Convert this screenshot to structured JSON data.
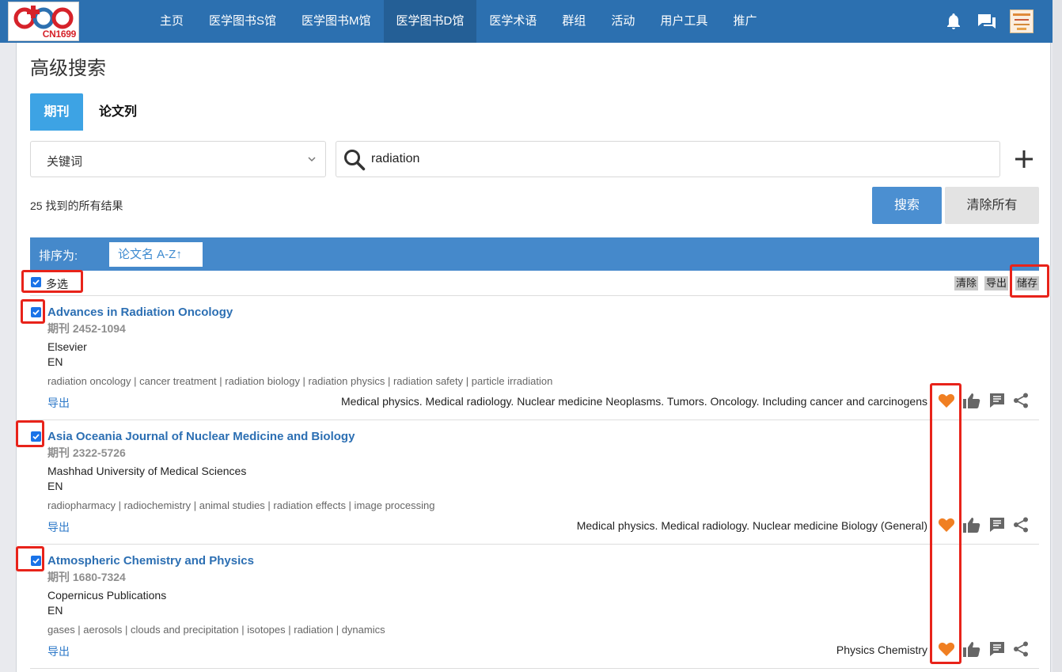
{
  "nav": {
    "logo_text": "CN1699",
    "items": [
      "主页",
      "医学图书S馆",
      "医学图书M馆",
      "医学图书D馆",
      "医学术语",
      "群组",
      "活动",
      "用户工具",
      "推广"
    ],
    "active": "医学图书D馆"
  },
  "page": {
    "title": "高级搜索"
  },
  "tabs": {
    "journal": "期刊",
    "papers": "论文列"
  },
  "search": {
    "field_selected": "关键词",
    "query": "radiation",
    "result_count": "25 找到的所有结果",
    "search_label": "搜索",
    "clear_label": "清除所有"
  },
  "sort": {
    "label": "排序为:",
    "value": "论文名 A-Z↑"
  },
  "select_bar": {
    "multi_label": "多选",
    "clear": "清除",
    "export": "导出",
    "save": "储存"
  },
  "results": [
    {
      "title": "Advances in Radiation Oncology",
      "issn": "期刊 2452-1094",
      "publisher": "Elsevier",
      "lang": "EN",
      "keywords": "radiation oncology | cancer treatment | radiation biology | radiation physics | radiation safety | particle irradiation",
      "export": "导出",
      "subjects": "Medical physics. Medical radiology. Nuclear medicine  Neoplasms. Tumors. Oncology. Including cancer and carcinogens",
      "checked": true
    },
    {
      "title": "Asia Oceania Journal of Nuclear Medicine and Biology",
      "issn": "期刊 2322-5726",
      "publisher": "Mashhad University of Medical Sciences",
      "lang": "EN",
      "keywords": "radiopharmacy | radiochemistry | animal studies | radiation effects | image processing",
      "export": "导出",
      "subjects": "Medical physics. Medical radiology. Nuclear medicine  Biology (General)",
      "checked": true
    },
    {
      "title": "Atmospheric Chemistry and Physics",
      "issn": "期刊 1680-7324",
      "publisher": "Copernicus Publications",
      "lang": "EN",
      "keywords": "gases | aerosols | clouds and precipitation | isotopes | radiation | dynamics",
      "export": "导出",
      "subjects": "Physics  Chemistry",
      "checked": true
    }
  ],
  "icons": [
    "bell-icon",
    "chat-icon",
    "heart-icon",
    "thumbs-up-icon",
    "comment-icon",
    "share-icon",
    "search-icon",
    "plus-icon"
  ],
  "colors": {
    "nav": "#2c70b0",
    "accent": "#3da3e4",
    "heart": "#f07f22",
    "annotation": "#e8231a"
  }
}
